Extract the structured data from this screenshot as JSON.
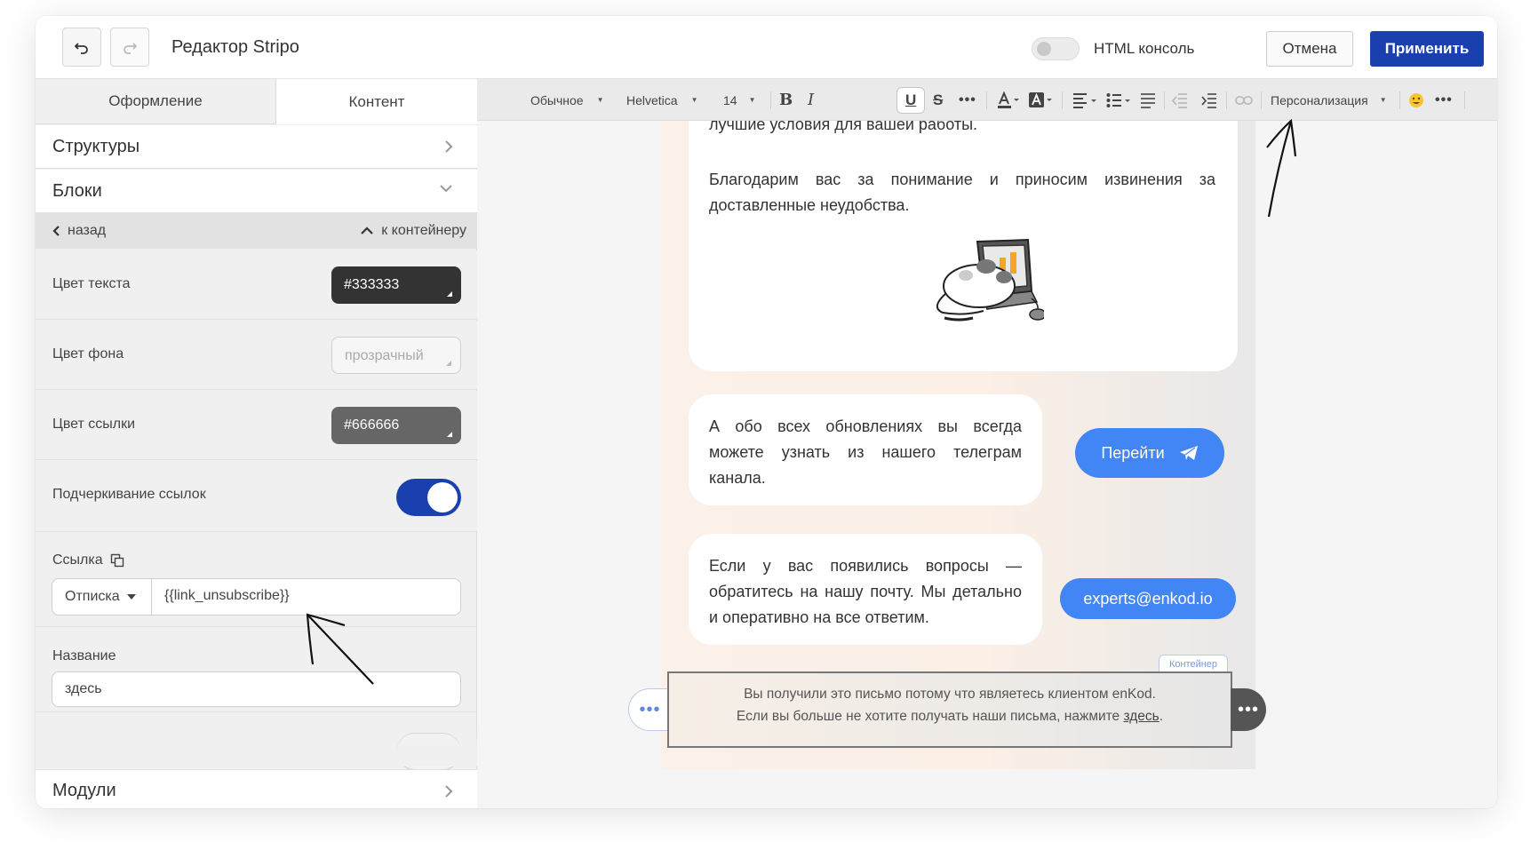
{
  "header": {
    "title": "Редактор Stripo",
    "html_console_label": "HTML консоль",
    "cancel_label": "Отмена",
    "apply_label": "Применить"
  },
  "sidebar": {
    "tabs": [
      {
        "label": "Оформление"
      },
      {
        "label": "Контент"
      }
    ],
    "structures_label": "Структуры",
    "blocks_label": "Блоки",
    "back_label": "назад",
    "to_container_label": "к контейнеру",
    "text_color": {
      "label": "Цвет текста",
      "value": "#333333"
    },
    "bg_color": {
      "label": "Цвет фона",
      "placeholder": "прозрачный"
    },
    "link_color": {
      "label": "Цвет ссылки",
      "value": "#666666"
    },
    "underline_links": {
      "label": "Подчеркивание ссылок",
      "on": true
    },
    "link": {
      "label": "Ссылка",
      "type": "Отписка",
      "value": "{{link_unsubscribe}}"
    },
    "name": {
      "label": "Название",
      "value": "здесь"
    },
    "modules_label": "Модули"
  },
  "toolbar": {
    "paragraph": "Обычное",
    "font": "Helvetica",
    "size": "14",
    "personalization": "Персонализация"
  },
  "email": {
    "cut_line": "лучшие условия для вашей работы.",
    "thanks": "Благодарим вас за понимание и приносим извинения за доставленные неудобства.",
    "updates": "А обо всех обновлениях вы всегда можете узнать из нашего телеграм канала.",
    "go_button": "Перейти",
    "questions": "Если у вас появились вопросы — обратитесь на нашу почту. Мы детально и оперативно на все ответим.",
    "email_button": "experts@enkod.io",
    "container_tag": "Контейнер",
    "footer_line1": "Вы получили это письмо потому что являетесь клиентом enKod.",
    "footer_line2_prefix": "Если вы больше не хотите получать наши письма, нажмите",
    "footer_link": "здесь",
    "footer_suffix": "."
  },
  "colors": {
    "accent": "#1a3faf",
    "button_blue": "#4285f4",
    "letter_bg": "#fbf1e9"
  }
}
